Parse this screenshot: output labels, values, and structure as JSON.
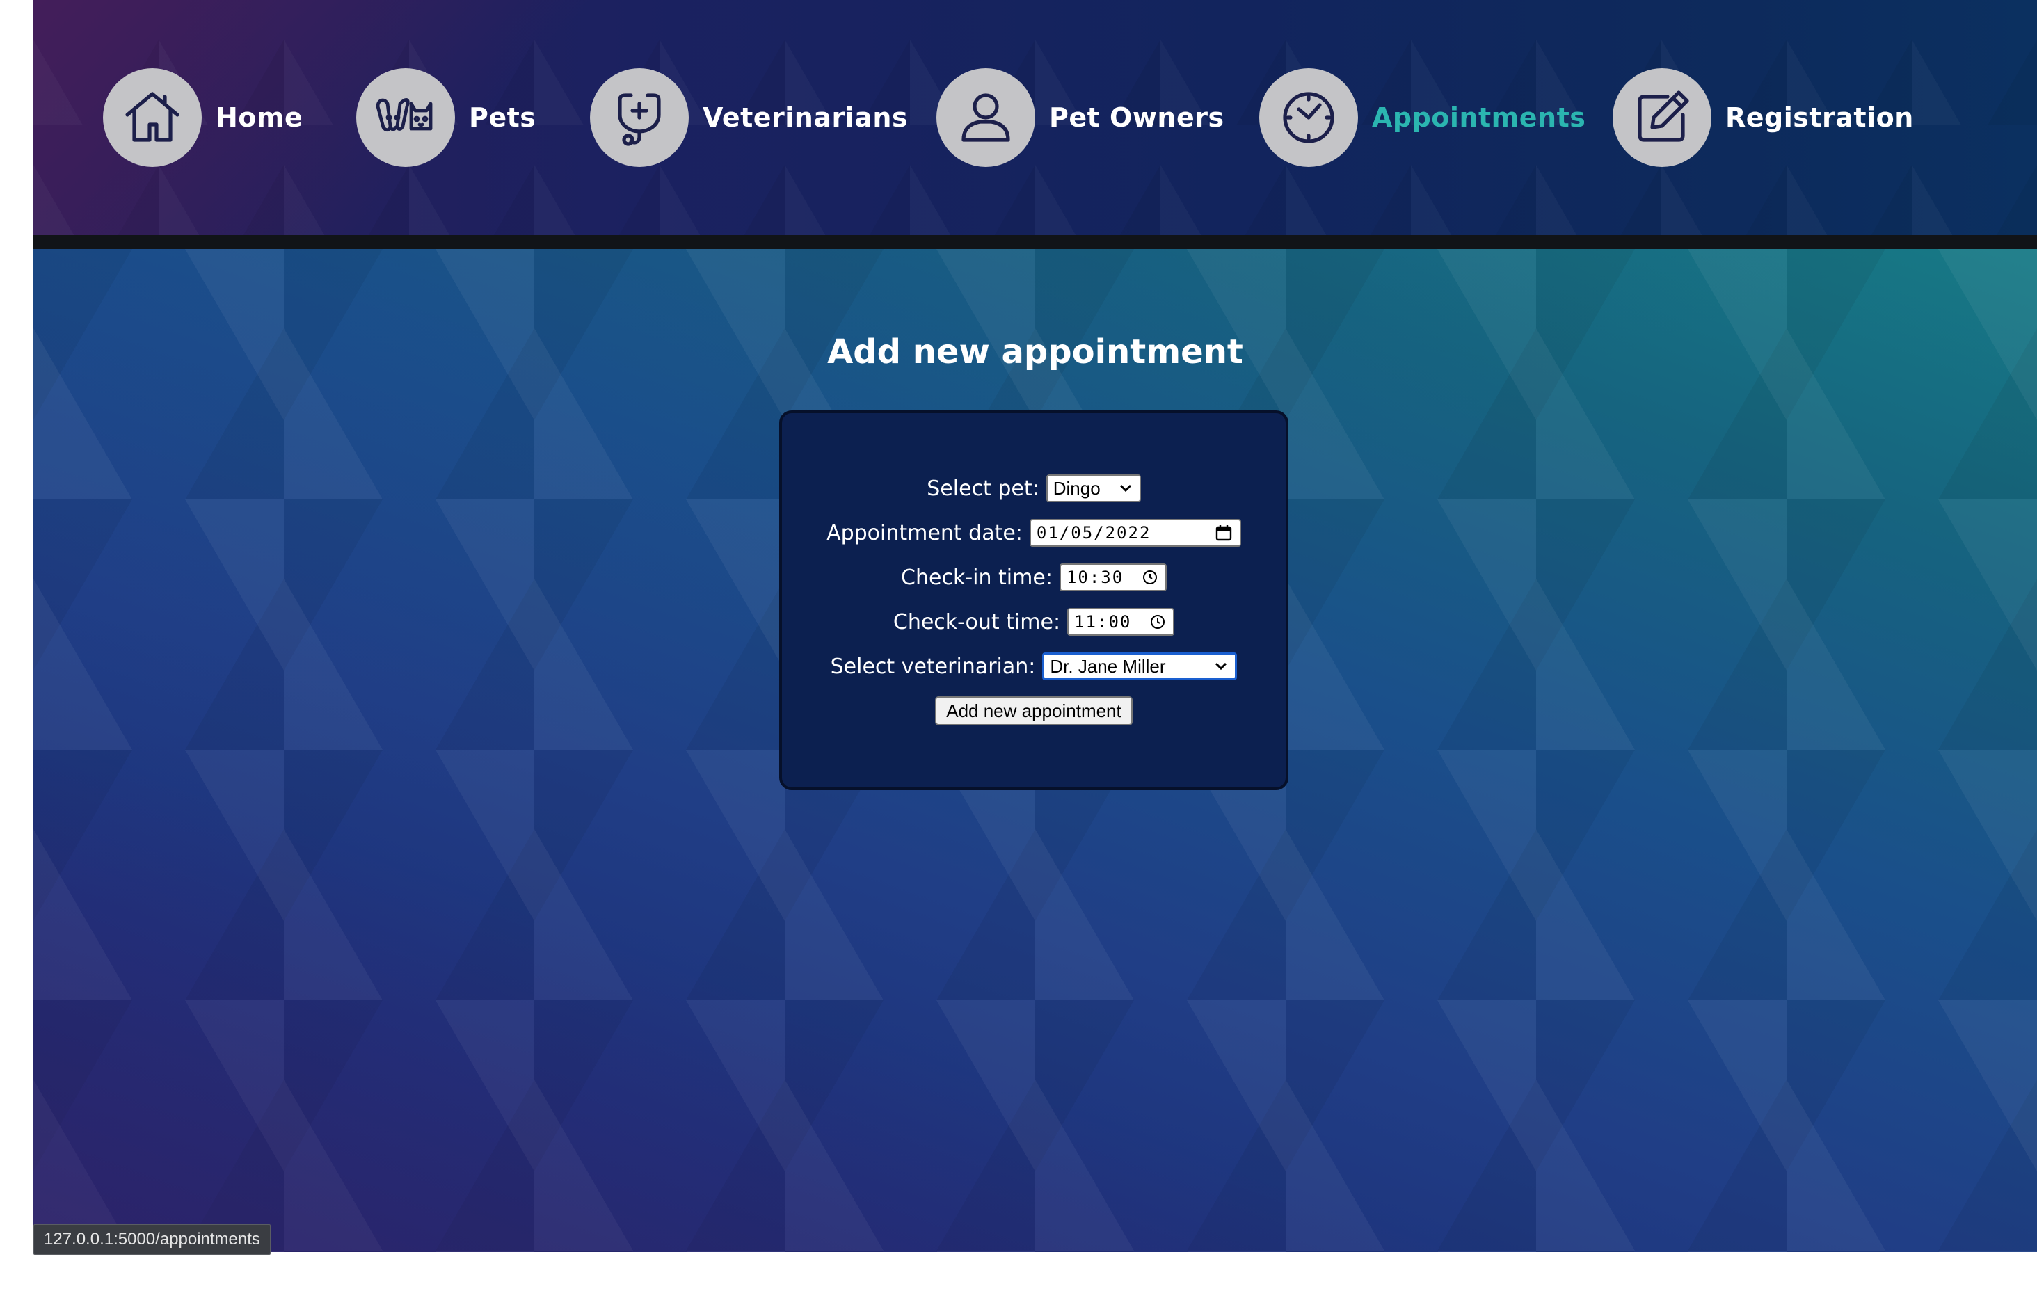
{
  "nav": {
    "items": [
      {
        "label": "Home",
        "icon": "home-icon",
        "active": false
      },
      {
        "label": "Pets",
        "icon": "pets-icon",
        "active": false
      },
      {
        "label": "Veterinarians",
        "icon": "stethoscope-icon",
        "active": false
      },
      {
        "label": "Pet Owners",
        "icon": "user-icon",
        "active": false
      },
      {
        "label": "Appointments",
        "icon": "clock-icon",
        "active": true
      },
      {
        "label": "Registration",
        "icon": "edit-icon",
        "active": false
      }
    ],
    "active_color": "#2bb5b0"
  },
  "page": {
    "title": "Add new appointment"
  },
  "form": {
    "pet_label": "Select pet:",
    "pet_value": "Dingo",
    "date_label": "Appointment date:",
    "date_value": "01/05/2022",
    "checkin_label": "Check-in time:",
    "checkin_value": "10:30",
    "checkout_label": "Check-out time:",
    "checkout_value": "11:00",
    "vet_label": "Select veterinarian:",
    "vet_value": "Dr. Jane Miller",
    "submit_label": "Add new appointment"
  },
  "status_bar": {
    "url": "127.0.0.1:5000/appointments"
  }
}
